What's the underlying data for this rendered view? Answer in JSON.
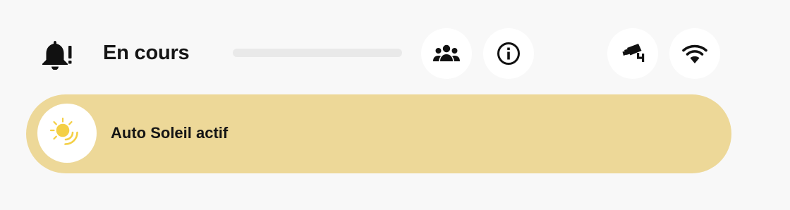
{
  "header": {
    "title": "En cours",
    "alert_icon": "bell-alert-icon",
    "progress": 0
  },
  "actions": [
    {
      "name": "people-button",
      "icon": "people-group-icon"
    },
    {
      "name": "info-button",
      "icon": "info-circle-icon"
    },
    {
      "name": "camera-button",
      "icon": "security-camera-icon"
    },
    {
      "name": "wifi-button",
      "icon": "wifi-icon"
    }
  ],
  "banner": {
    "text": "Auto Soleil actif",
    "icon": "sun-sensor-icon",
    "background_color": "#edd898",
    "icon_color": "#f4cf45"
  }
}
